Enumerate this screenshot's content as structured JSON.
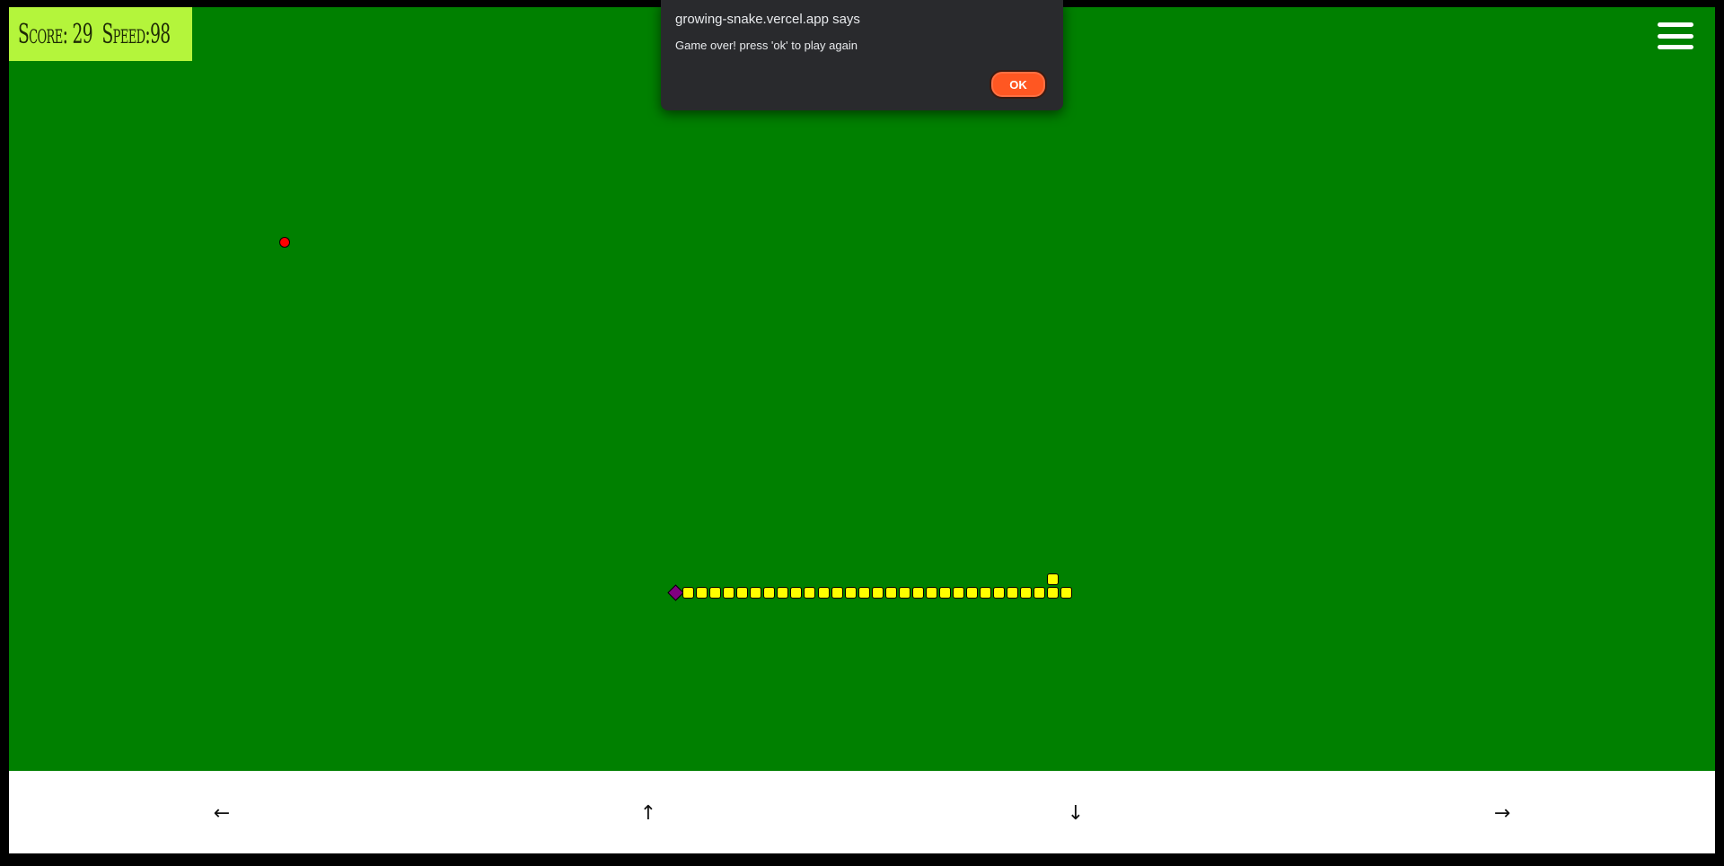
{
  "hud": {
    "score_label": "Score:",
    "score": "29",
    "speed_label": "Speed:",
    "speed": "98"
  },
  "menu_icon": "hamburger-menu-icon",
  "board": {
    "background": "#008000",
    "snake_body_color": "#ffff00",
    "snake_head_color": "#800080",
    "food_color": "#ff0000"
  },
  "controls": {
    "left": "←",
    "up": "↑",
    "down": "↓",
    "right": "→"
  },
  "dialog": {
    "title": "growing-snake.vercel.app says",
    "message": "Game over! press 'ok' to play again",
    "ok_label": "OK"
  }
}
